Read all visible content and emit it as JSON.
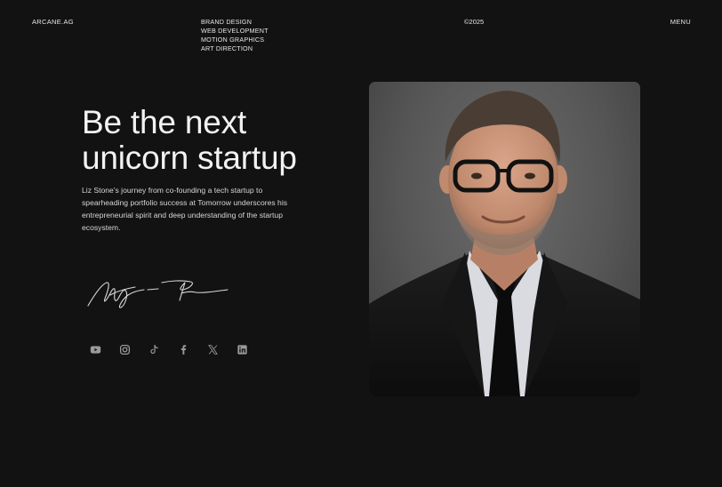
{
  "header": {
    "logo": "ARCANE.AG",
    "services": [
      "BRAND DESIGN",
      "WEB DEVELOPMENT",
      "MOTION GRAPHICS",
      "ART DIRECTION"
    ],
    "copyright": "©2025",
    "menu_label": "MENU"
  },
  "hero": {
    "headline_line1": "Be the next",
    "headline_line2": "unicorn startup",
    "bio": "Liz Stone's journey from co-founding a tech startup to spearheading portfolio success at Tomorrow underscores his entrepreneurial spirit and deep understanding of the startup ecosystem."
  },
  "socials": [
    {
      "icon": "youtube-icon"
    },
    {
      "icon": "instagram-icon"
    },
    {
      "icon": "tiktok-icon"
    },
    {
      "icon": "facebook-icon"
    },
    {
      "icon": "x-icon"
    },
    {
      "icon": "linkedin-icon"
    }
  ],
  "colors": {
    "background": "#121212",
    "text": "#e9e9e9",
    "icon": "#9a9a9a"
  }
}
